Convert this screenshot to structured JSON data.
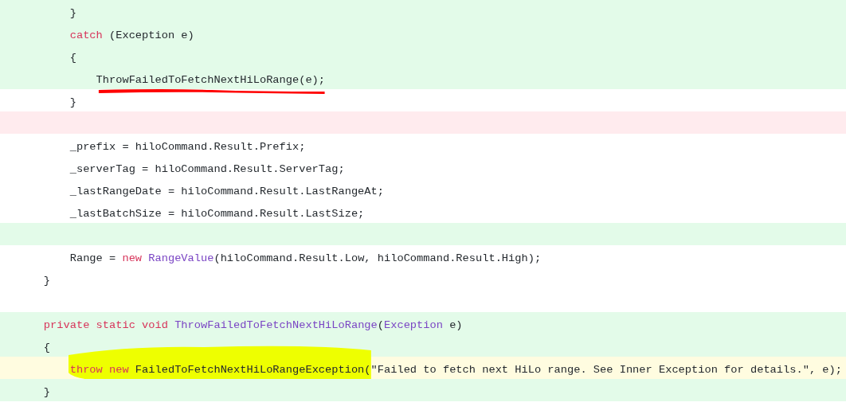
{
  "code_view": {
    "lines": [
      {
        "kind": "added",
        "tokens": [
          {
            "kind": "plain",
            "text": "        }"
          }
        ]
      },
      {
        "kind": "added",
        "tokens": [
          {
            "kind": "keyword",
            "text": "        catch"
          },
          {
            "kind": "plain",
            "text": " (Exception e)"
          }
        ]
      },
      {
        "kind": "added",
        "tokens": [
          {
            "kind": "plain",
            "text": "        {"
          }
        ]
      },
      {
        "kind": "added",
        "annotation": {
          "kind": "underline"
        },
        "tokens": [
          {
            "kind": "plain",
            "text": "            ThrowFailedToFetchNextHiLoRange(e);",
            "marked": true
          }
        ]
      },
      {
        "kind": "context",
        "tokens": [
          {
            "kind": "plain",
            "text": "        }"
          }
        ]
      },
      {
        "kind": "removed"
      },
      {
        "kind": "context",
        "tokens": [
          {
            "kind": "plain",
            "text": "        _prefix = hiloCommand.Result.Prefix;"
          }
        ]
      },
      {
        "kind": "context",
        "tokens": [
          {
            "kind": "plain",
            "text": "        _serverTag = hiloCommand.Result.ServerTag;"
          }
        ]
      },
      {
        "kind": "context",
        "tokens": [
          {
            "kind": "plain",
            "text": "        _lastRangeDate = hiloCommand.Result.LastRangeAt;"
          }
        ]
      },
      {
        "kind": "context",
        "tokens": [
          {
            "kind": "plain",
            "text": "        _lastBatchSize = hiloCommand.Result.LastSize;"
          }
        ]
      },
      {
        "kind": "added"
      },
      {
        "kind": "context",
        "tokens": [
          {
            "kind": "plain",
            "text": "        Range = "
          },
          {
            "kind": "keyword",
            "text": "new"
          },
          {
            "kind": "type",
            "text": " RangeValue"
          },
          {
            "kind": "plain",
            "text": "(hiloCommand.Result.Low, hiloCommand.Result.High);"
          }
        ]
      },
      {
        "kind": "context",
        "tokens": [
          {
            "kind": "plain",
            "text": "    }"
          }
        ]
      },
      {
        "kind": "context"
      },
      {
        "kind": "added",
        "tokens": [
          {
            "kind": "keyword",
            "text": "    private static void "
          },
          {
            "kind": "type",
            "text": "ThrowFailedToFetchNextHiLoRange"
          },
          {
            "kind": "plain",
            "text": "("
          },
          {
            "kind": "type",
            "text": "Exception"
          },
          {
            "kind": "plain",
            "text": " e)"
          }
        ]
      },
      {
        "kind": "added",
        "tokens": [
          {
            "kind": "plain",
            "text": "    {"
          }
        ]
      },
      {
        "kind": "current",
        "annotation": {
          "kind": "highlight"
        },
        "tokens": [
          {
            "kind": "keyword",
            "text": "        throw new",
            "marked": true
          },
          {
            "kind": "plain",
            "text": " FailedToFetchNextHiLoRangeException(",
            "marked": true
          },
          {
            "kind": "plain",
            "text": "\"Failed to fetch next HiLo range. See Inner Exception for details.\", e);"
          }
        ]
      },
      {
        "kind": "added",
        "tokens": [
          {
            "kind": "plain",
            "text": "    }"
          }
        ]
      }
    ]
  }
}
